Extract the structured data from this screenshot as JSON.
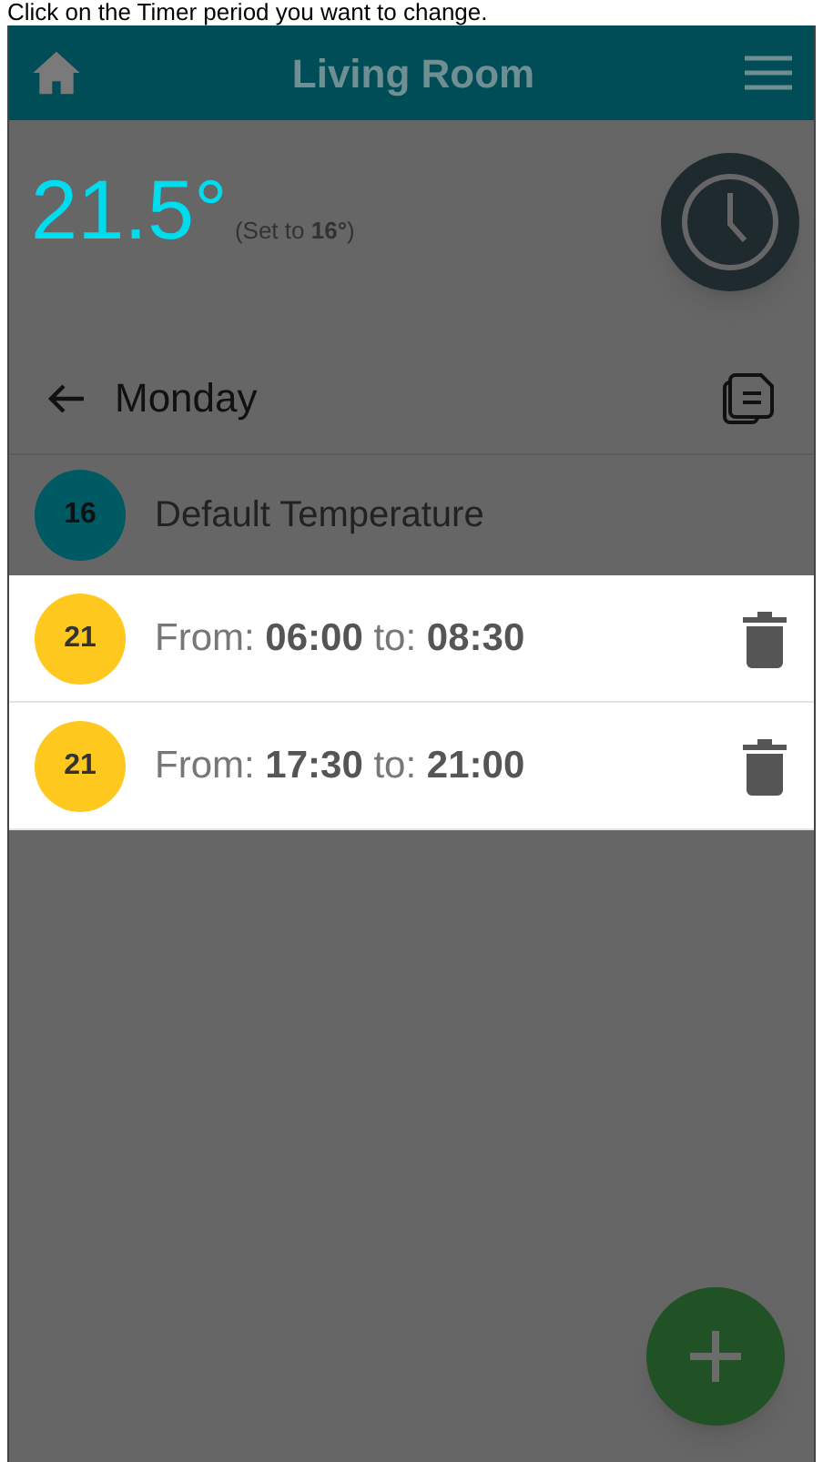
{
  "caption": "Click on the Timer period you want to change.",
  "header": {
    "title": "Living Room"
  },
  "status": {
    "temperature": "21.5°",
    "setpoint": "(Set to **16°**)"
  },
  "day": {
    "title": "Monday"
  },
  "default": {
    "badge": "16",
    "label": "Default Temperature",
    "color": "#005a64"
  },
  "timers": [
    {
      "badge": "21",
      "text": "From: **06:00** to: **08:30**",
      "color": "#ffc81e",
      "highlighted": true
    },
    {
      "badge": "21",
      "text": "From: **17:30** to: **21:00**",
      "color": "#ffc81e",
      "highlighted": true
    }
  ]
}
